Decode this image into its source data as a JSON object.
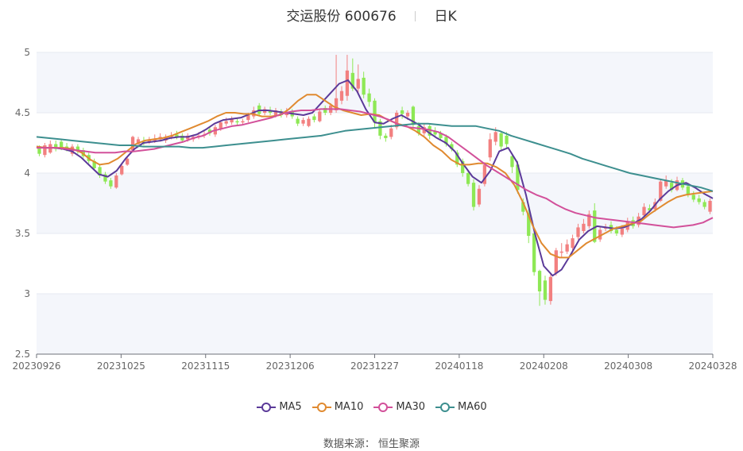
{
  "header": {
    "stock": "交运股份 600676",
    "period": "日K"
  },
  "source": "数据来源： 恒生聚源",
  "legend": [
    {
      "name": "MA5",
      "color": "#5b3a99"
    },
    {
      "name": "MA10",
      "color": "#e08a30"
    },
    {
      "name": "MA30",
      "color": "#d2509a"
    },
    {
      "name": "MA60",
      "color": "#3d8f8f"
    }
  ],
  "colors": {
    "up": "#f28080",
    "down": "#8ee855",
    "grid": "#e6e9f2",
    "band": "#f4f6fb",
    "axis": "#666666"
  },
  "chart_data": {
    "type": "candlestick",
    "ylim": [
      2.5,
      5
    ],
    "yticks": [
      "5",
      "4.5",
      "4",
      "3.5",
      "3",
      "2.5"
    ],
    "xticks": [
      "20230926",
      "20231025",
      "20231115",
      "20231206",
      "20231227",
      "20240118",
      "20240208",
      "20240308",
      "20240328"
    ],
    "candles": [
      {
        "o": 4.21,
        "c": 4.16,
        "h": 4.23,
        "l": 4.14
      },
      {
        "o": 4.15,
        "c": 4.23,
        "h": 4.25,
        "l": 4.13
      },
      {
        "o": 4.17,
        "c": 4.24,
        "h": 4.27,
        "l": 4.16
      },
      {
        "o": 4.24,
        "c": 4.2,
        "h": 4.27,
        "l": 4.18
      },
      {
        "o": 4.26,
        "c": 4.21,
        "h": 4.28,
        "l": 4.19
      },
      {
        "o": 4.22,
        "c": 4.2,
        "h": 4.25,
        "l": 4.18
      },
      {
        "o": 4.16,
        "c": 4.22,
        "h": 4.24,
        "l": 4.14
      },
      {
        "o": 4.22,
        "c": 4.18,
        "h": 4.24,
        "l": 4.16
      },
      {
        "o": 4.19,
        "c": 4.14,
        "h": 4.21,
        "l": 4.12
      },
      {
        "o": 4.15,
        "c": 4.1,
        "h": 4.17,
        "l": 4.08
      },
      {
        "o": 4.1,
        "c": 4.04,
        "h": 4.12,
        "l": 4.02
      },
      {
        "o": 4.05,
        "c": 3.98,
        "h": 4.07,
        "l": 3.96
      },
      {
        "o": 3.99,
        "c": 3.93,
        "h": 4.01,
        "l": 3.91
      },
      {
        "o": 3.94,
        "c": 3.89,
        "h": 3.96,
        "l": 3.87
      },
      {
        "o": 3.88,
        "c": 3.98,
        "h": 4.0,
        "l": 3.87
      },
      {
        "o": 3.99,
        "c": 4.06,
        "h": 4.08,
        "l": 3.98
      },
      {
        "o": 4.07,
        "c": 4.12,
        "h": 4.14,
        "l": 4.06
      },
      {
        "o": 4.19,
        "c": 4.3,
        "h": 4.31,
        "l": 4.17
      },
      {
        "o": 4.24,
        "c": 4.28,
        "h": 4.3,
        "l": 4.22
      },
      {
        "o": 4.26,
        "c": 4.25,
        "h": 4.3,
        "l": 4.23
      },
      {
        "o": 4.26,
        "c": 4.28,
        "h": 4.3,
        "l": 4.24
      },
      {
        "o": 4.27,
        "c": 4.28,
        "h": 4.32,
        "l": 4.25
      },
      {
        "o": 4.28,
        "c": 4.3,
        "h": 4.33,
        "l": 4.26
      },
      {
        "o": 4.27,
        "c": 4.3,
        "h": 4.32,
        "l": 4.25
      },
      {
        "o": 4.3,
        "c": 4.31,
        "h": 4.34,
        "l": 4.28
      },
      {
        "o": 4.32,
        "c": 4.3,
        "h": 4.35,
        "l": 4.28
      },
      {
        "o": 4.31,
        "c": 4.27,
        "h": 4.33,
        "l": 4.25
      },
      {
        "o": 4.28,
        "c": 4.31,
        "h": 4.33,
        "l": 4.26
      },
      {
        "o": 4.28,
        "c": 4.3,
        "h": 4.32,
        "l": 4.26
      },
      {
        "o": 4.3,
        "c": 4.31,
        "h": 4.34,
        "l": 4.28
      },
      {
        "o": 4.31,
        "c": 4.32,
        "h": 4.35,
        "l": 4.29
      },
      {
        "o": 4.36,
        "c": 4.33,
        "h": 4.38,
        "l": 4.31
      },
      {
        "o": 4.32,
        "c": 4.38,
        "h": 4.4,
        "l": 4.3
      },
      {
        "o": 4.37,
        "c": 4.42,
        "h": 4.44,
        "l": 4.35
      },
      {
        "o": 4.41,
        "c": 4.43,
        "h": 4.46,
        "l": 4.39
      },
      {
        "o": 4.42,
        "c": 4.45,
        "h": 4.47,
        "l": 4.4
      },
      {
        "o": 4.43,
        "c": 4.42,
        "h": 4.46,
        "l": 4.4
      },
      {
        "o": 4.42,
        "c": 4.43,
        "h": 4.45,
        "l": 4.4
      },
      {
        "o": 4.44,
        "c": 4.48,
        "h": 4.5,
        "l": 4.42
      },
      {
        "o": 4.47,
        "c": 4.52,
        "h": 4.55,
        "l": 4.45
      },
      {
        "o": 4.56,
        "c": 4.49,
        "h": 4.58,
        "l": 4.47
      },
      {
        "o": 4.5,
        "c": 4.53,
        "h": 4.55,
        "l": 4.48
      },
      {
        "o": 4.52,
        "c": 4.5,
        "h": 4.55,
        "l": 4.48
      },
      {
        "o": 4.48,
        "c": 4.52,
        "h": 4.54,
        "l": 4.46
      },
      {
        "o": 4.51,
        "c": 4.48,
        "h": 4.53,
        "l": 4.46
      },
      {
        "o": 4.48,
        "c": 4.51,
        "h": 4.54,
        "l": 4.46
      },
      {
        "o": 4.51,
        "c": 4.47,
        "h": 4.53,
        "l": 4.45
      },
      {
        "o": 4.45,
        "c": 4.41,
        "h": 4.47,
        "l": 4.39
      },
      {
        "o": 4.41,
        "c": 4.44,
        "h": 4.46,
        "l": 4.39
      },
      {
        "o": 4.39,
        "c": 4.45,
        "h": 4.47,
        "l": 4.38
      },
      {
        "o": 4.47,
        "c": 4.44,
        "h": 4.49,
        "l": 4.42
      },
      {
        "o": 4.43,
        "c": 4.51,
        "h": 4.53,
        "l": 4.42
      },
      {
        "o": 4.54,
        "c": 4.5,
        "h": 4.56,
        "l": 4.48
      },
      {
        "o": 4.5,
        "c": 4.56,
        "h": 4.58,
        "l": 4.48
      },
      {
        "o": 4.52,
        "c": 4.62,
        "h": 4.98,
        "l": 4.5
      },
      {
        "o": 4.6,
        "c": 4.68,
        "h": 4.72,
        "l": 4.57
      },
      {
        "o": 4.64,
        "c": 4.85,
        "h": 4.98,
        "l": 4.6
      },
      {
        "o": 4.83,
        "c": 4.7,
        "h": 4.95,
        "l": 4.68
      },
      {
        "o": 4.7,
        "c": 4.78,
        "h": 4.9,
        "l": 4.65
      },
      {
        "o": 4.79,
        "c": 4.65,
        "h": 4.84,
        "l": 4.62
      },
      {
        "o": 4.66,
        "c": 4.59,
        "h": 4.7,
        "l": 4.55
      },
      {
        "o": 4.6,
        "c": 4.42,
        "h": 4.62,
        "l": 4.38
      },
      {
        "o": 4.43,
        "c": 4.31,
        "h": 4.45,
        "l": 4.28
      },
      {
        "o": 4.31,
        "c": 4.29,
        "h": 4.33,
        "l": 4.26
      },
      {
        "o": 4.3,
        "c": 4.37,
        "h": 4.4,
        "l": 4.28
      },
      {
        "o": 4.38,
        "c": 4.5,
        "h": 4.52,
        "l": 4.36
      },
      {
        "o": 4.52,
        "c": 4.49,
        "h": 4.55,
        "l": 4.45
      },
      {
        "o": 4.47,
        "c": 4.5,
        "h": 4.52,
        "l": 4.44
      },
      {
        "o": 4.55,
        "c": 4.4,
        "h": 4.56,
        "l": 4.38
      },
      {
        "o": 4.39,
        "c": 4.33,
        "h": 4.42,
        "l": 4.31
      },
      {
        "o": 4.33,
        "c": 4.38,
        "h": 4.41,
        "l": 4.31
      },
      {
        "o": 4.39,
        "c": 4.31,
        "h": 4.4,
        "l": 4.28
      },
      {
        "o": 4.35,
        "c": 4.32,
        "h": 4.38,
        "l": 4.3
      },
      {
        "o": 4.33,
        "c": 4.29,
        "h": 4.35,
        "l": 4.27
      },
      {
        "o": 4.3,
        "c": 4.24,
        "h": 4.32,
        "l": 4.22
      },
      {
        "o": 4.24,
        "c": 4.2,
        "h": 4.26,
        "l": 4.18
      },
      {
        "o": 4.17,
        "c": 4.07,
        "h": 4.19,
        "l": 4.05
      },
      {
        "o": 4.1,
        "c": 4.0,
        "h": 4.12,
        "l": 3.97
      },
      {
        "o": 4.0,
        "c": 3.91,
        "h": 4.02,
        "l": 3.89
      },
      {
        "o": 3.92,
        "c": 3.72,
        "h": 3.95,
        "l": 3.69
      },
      {
        "o": 3.74,
        "c": 3.87,
        "h": 3.9,
        "l": 3.72
      },
      {
        "o": 3.91,
        "c": 4.07,
        "h": 4.09,
        "l": 3.89
      },
      {
        "o": 4.13,
        "c": 4.28,
        "h": 4.33,
        "l": 4.1
      },
      {
        "o": 4.26,
        "c": 4.34,
        "h": 4.38,
        "l": 4.23
      },
      {
        "o": 4.33,
        "c": 4.22,
        "h": 4.35,
        "l": 4.19
      },
      {
        "o": 4.31,
        "c": 4.24,
        "h": 4.34,
        "l": 4.21
      },
      {
        "o": 4.14,
        "c": 4.05,
        "h": 4.16,
        "l": 4.0
      },
      {
        "o": 4.07,
        "c": 3.86,
        "h": 4.1,
        "l": 3.83
      },
      {
        "o": 3.76,
        "c": 3.68,
        "h": 3.79,
        "l": 3.65
      },
      {
        "o": 3.67,
        "c": 3.48,
        "h": 3.7,
        "l": 3.42
      },
      {
        "o": 3.5,
        "c": 3.18,
        "h": 3.52,
        "l": 3.15
      },
      {
        "o": 3.19,
        "c": 3.02,
        "h": 3.2,
        "l": 2.9
      },
      {
        "o": 3.11,
        "c": 2.95,
        "h": 3.15,
        "l": 2.91
      },
      {
        "o": 2.94,
        "c": 3.14,
        "h": 3.17,
        "l": 2.91
      },
      {
        "o": 3.17,
        "c": 3.36,
        "h": 3.38,
        "l": 3.15
      },
      {
        "o": 3.34,
        "c": 3.35,
        "h": 3.42,
        "l": 3.3
      },
      {
        "o": 3.35,
        "c": 3.41,
        "h": 3.45,
        "l": 3.33
      },
      {
        "o": 3.38,
        "c": 3.46,
        "h": 3.49,
        "l": 3.36
      },
      {
        "o": 3.47,
        "c": 3.55,
        "h": 3.58,
        "l": 3.45
      },
      {
        "o": 3.52,
        "c": 3.58,
        "h": 3.62,
        "l": 3.5
      },
      {
        "o": 3.56,
        "c": 3.66,
        "h": 3.69,
        "l": 3.54
      },
      {
        "o": 3.69,
        "c": 3.43,
        "h": 3.75,
        "l": 3.42
      },
      {
        "o": 3.45,
        "c": 3.53,
        "h": 3.56,
        "l": 3.43
      },
      {
        "o": 3.54,
        "c": 3.55,
        "h": 3.58,
        "l": 3.52
      },
      {
        "o": 3.57,
        "c": 3.52,
        "h": 3.6,
        "l": 3.5
      },
      {
        "o": 3.53,
        "c": 3.5,
        "h": 3.56,
        "l": 3.48
      },
      {
        "o": 3.49,
        "c": 3.54,
        "h": 3.57,
        "l": 3.47
      },
      {
        "o": 3.53,
        "c": 3.6,
        "h": 3.63,
        "l": 3.51
      },
      {
        "o": 3.61,
        "c": 3.56,
        "h": 3.64,
        "l": 3.54
      },
      {
        "o": 3.57,
        "c": 3.64,
        "h": 3.67,
        "l": 3.55
      },
      {
        "o": 3.65,
        "c": 3.72,
        "h": 3.75,
        "l": 3.63
      },
      {
        "o": 3.71,
        "c": 3.69,
        "h": 3.74,
        "l": 3.67
      },
      {
        "o": 3.7,
        "c": 3.76,
        "h": 3.79,
        "l": 3.68
      },
      {
        "o": 3.77,
        "c": 3.93,
        "h": 3.95,
        "l": 3.76
      },
      {
        "o": 3.89,
        "c": 3.94,
        "h": 3.98,
        "l": 3.87
      },
      {
        "o": 3.92,
        "c": 3.86,
        "h": 3.95,
        "l": 3.84
      },
      {
        "o": 3.86,
        "c": 3.94,
        "h": 3.97,
        "l": 3.85
      },
      {
        "o": 3.94,
        "c": 3.88,
        "h": 3.96,
        "l": 3.86
      },
      {
        "o": 3.89,
        "c": 3.82,
        "h": 3.92,
        "l": 3.8
      },
      {
        "o": 3.82,
        "c": 3.78,
        "h": 3.85,
        "l": 3.76
      },
      {
        "o": 3.79,
        "c": 3.76,
        "h": 3.82,
        "l": 3.74
      },
      {
        "o": 3.76,
        "c": 3.72,
        "h": 3.78,
        "l": 3.7
      },
      {
        "o": 3.68,
        "c": 3.77,
        "h": 3.79,
        "l": 3.66
      }
    ],
    "ma": {
      "MA5": [
        4.22,
        4.21,
        4.21,
        4.2,
        4.18,
        4.13,
        4.06,
        3.99,
        3.97,
        4.02,
        4.12,
        4.2,
        4.25,
        4.26,
        4.27,
        4.29,
        4.3,
        4.3,
        4.32,
        4.36,
        4.41,
        4.44,
        4.45,
        4.46,
        4.49,
        4.52,
        4.52,
        4.51,
        4.5,
        4.49,
        4.48,
        4.5,
        4.58,
        4.66,
        4.74,
        4.77,
        4.68,
        4.53,
        4.42,
        4.41,
        4.45,
        4.48,
        4.44,
        4.4,
        4.34,
        4.29,
        4.25,
        4.18,
        4.07,
        3.97,
        3.92,
        4.02,
        4.18,
        4.21,
        4.09,
        3.82,
        3.5,
        3.23,
        3.15,
        3.2,
        3.32,
        3.45,
        3.52,
        3.56,
        3.55,
        3.54,
        3.55,
        3.58,
        3.62,
        3.69,
        3.78,
        3.85,
        3.9,
        3.92,
        3.88,
        3.83,
        3.79
      ],
      "MA10": [
        4.22,
        4.21,
        4.21,
        4.21,
        4.2,
        4.17,
        4.11,
        4.07,
        4.08,
        4.12,
        4.18,
        4.24,
        4.27,
        4.28,
        4.29,
        4.31,
        4.34,
        4.37,
        4.4,
        4.43,
        4.47,
        4.5,
        4.5,
        4.49,
        4.49,
        4.47,
        4.47,
        4.48,
        4.53,
        4.6,
        4.65,
        4.65,
        4.6,
        4.55,
        4.52,
        4.5,
        4.48,
        4.49,
        4.48,
        4.44,
        4.41,
        4.39,
        4.35,
        4.3,
        4.23,
        4.18,
        4.11,
        4.07,
        4.07,
        4.08,
        4.08,
        4.05,
        4.0,
        3.9,
        3.75,
        3.57,
        3.42,
        3.33,
        3.3,
        3.3,
        3.36,
        3.42,
        3.46,
        3.5,
        3.54,
        3.56,
        3.58,
        3.6,
        3.66,
        3.71,
        3.76,
        3.8,
        3.82,
        3.83,
        3.84,
        3.85
      ],
      "MA30": [
        4.21,
        4.21,
        4.21,
        4.2,
        4.19,
        4.18,
        4.17,
        4.17,
        4.17,
        4.18,
        4.18,
        4.19,
        4.2,
        4.22,
        4.24,
        4.26,
        4.29,
        4.31,
        4.35,
        4.37,
        4.39,
        4.4,
        4.42,
        4.44,
        4.46,
        4.49,
        4.51,
        4.52,
        4.52,
        4.53,
        4.53,
        4.53,
        4.52,
        4.51,
        4.49,
        4.47,
        4.44,
        4.4,
        4.38,
        4.37,
        4.36,
        4.34,
        4.3,
        4.24,
        4.18,
        4.12,
        4.06,
        4.01,
        3.96,
        3.91,
        3.86,
        3.82,
        3.79,
        3.74,
        3.7,
        3.67,
        3.65,
        3.63,
        3.62,
        3.61,
        3.6,
        3.59,
        3.58,
        3.57,
        3.56,
        3.55,
        3.56,
        3.57,
        3.59,
        3.63
      ],
      "MA60": [
        4.3,
        4.29,
        4.28,
        4.27,
        4.26,
        4.25,
        4.24,
        4.23,
        4.23,
        4.22,
        4.22,
        4.22,
        4.22,
        4.21,
        4.21,
        4.22,
        4.23,
        4.24,
        4.25,
        4.26,
        4.27,
        4.28,
        4.29,
        4.3,
        4.31,
        4.33,
        4.35,
        4.36,
        4.37,
        4.38,
        4.39,
        4.4,
        4.41,
        4.41,
        4.4,
        4.39,
        4.39,
        4.39,
        4.37,
        4.35,
        4.31,
        4.28,
        4.25,
        4.22,
        4.19,
        4.16,
        4.12,
        4.09,
        4.06,
        4.03,
        4.0,
        3.98,
        3.96,
        3.94,
        3.92,
        3.9,
        3.88,
        3.85
      ]
    }
  }
}
